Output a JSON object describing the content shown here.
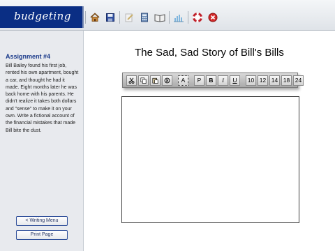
{
  "brand": {
    "name": "budgeting"
  },
  "top_toolbar": {
    "icons": [
      "home-icon",
      "save-icon",
      "edit-icon",
      "calculator-icon",
      "book-icon",
      "chart-icon",
      "lifebuoy-icon",
      "close-icon"
    ]
  },
  "sidebar": {
    "assignment_title": "Assignment #4",
    "assignment_text": "Bill Bailey found his first job, rented his own apartment, bought a car, and thought he had it made. Eight months later he was back home with his parents. He didn't realize it takes both dollars and \"sense\" to make it on your own. Write a fictional account of the financial mistakes that made Bill bite the dust.",
    "writing_menu_label": "< Writing Menu",
    "print_label": "Print Page"
  },
  "main": {
    "title": "The Sad, Sad Story of Bill's Bills",
    "text_value": ""
  },
  "edit_toolbar": {
    "font_color_label": "A",
    "plain_label": "P",
    "bold_label": "B",
    "italic_label": "I",
    "underline_label": "U",
    "sizes": [
      "10",
      "12",
      "14",
      "18",
      "24"
    ]
  }
}
